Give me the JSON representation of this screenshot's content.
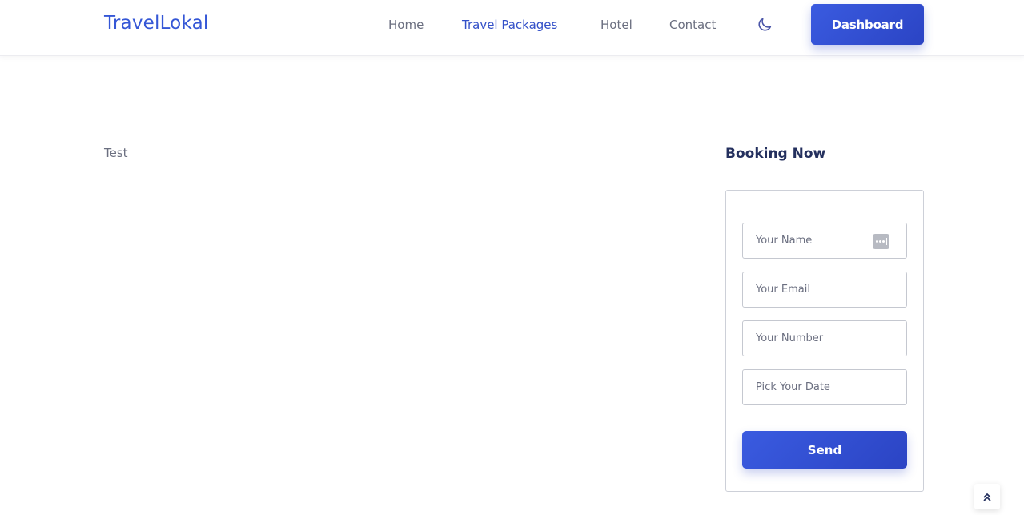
{
  "header": {
    "brand": "TravelLokal",
    "nav": [
      {
        "label": "Home"
      },
      {
        "label": "Travel Packages",
        "active": true
      },
      {
        "label": "Hotel"
      },
      {
        "label": "Contact"
      }
    ],
    "theme_icon": "moon-icon",
    "dashboard_label": "Dashboard"
  },
  "main": {
    "content_text": "Test"
  },
  "booking": {
    "title": "Booking Now",
    "fields": {
      "name_placeholder": "Your Name",
      "email_placeholder": "Your Email",
      "number_placeholder": "Your Number",
      "date_placeholder": "Pick Your Date"
    },
    "password_manager_icon": "password-manager-icon",
    "send_label": "Send"
  },
  "scroll_top_icon": "double-chevron-up-icon",
  "colors": {
    "accent": "#3557d6",
    "button_gradient_start": "#3a5be0",
    "button_gradient_end": "#2b44c4",
    "title_dark": "#24305e"
  }
}
